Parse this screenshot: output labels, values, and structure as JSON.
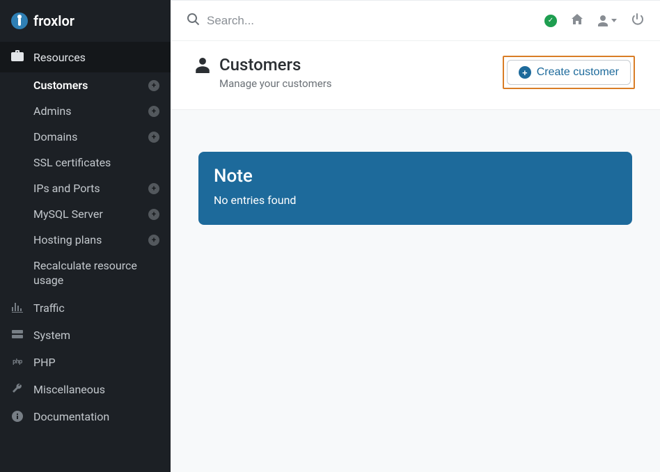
{
  "brand": "froxlor",
  "sidebar": {
    "sections": [
      {
        "label": "Resources",
        "items": [
          {
            "label": "Customers",
            "add": true,
            "active": true
          },
          {
            "label": "Admins",
            "add": true
          },
          {
            "label": "Domains",
            "add": true
          },
          {
            "label": "SSL certificates",
            "add": false
          },
          {
            "label": "IPs and Ports",
            "add": true
          },
          {
            "label": "MySQL Server",
            "add": true
          },
          {
            "label": "Hosting plans",
            "add": true
          },
          {
            "label": "Recalculate resource usage",
            "add": false
          }
        ]
      }
    ],
    "other": [
      {
        "label": "Traffic",
        "icon": "chart-icon"
      },
      {
        "label": "System",
        "icon": "server-icon"
      },
      {
        "label": "PHP",
        "icon": "php-icon"
      },
      {
        "label": "Miscellaneous",
        "icon": "wrench-icon"
      },
      {
        "label": "Documentation",
        "icon": "info-icon"
      }
    ]
  },
  "search": {
    "placeholder": "Search..."
  },
  "page": {
    "title": "Customers",
    "subtitle": "Manage your customers",
    "create_label": "Create customer"
  },
  "note": {
    "title": "Note",
    "message": "No entries found"
  }
}
